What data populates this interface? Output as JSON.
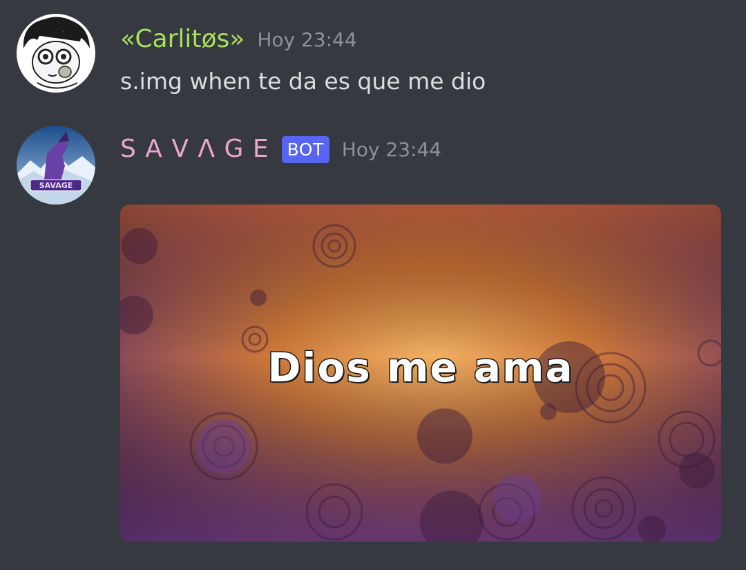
{
  "messages": [
    {
      "username": "«Carlitøs»",
      "username_color": "#a8e05f",
      "timestamp": "Hoy 23:44",
      "text": "s.img when te da es que me dio",
      "avatar": "cartoon-face-avatar"
    },
    {
      "username": "S A V Λ G E",
      "username_color": "#e8a6d0",
      "badge": "BOT",
      "timestamp": "Hoy 23:44",
      "avatar": "howling-wolf-logo-avatar",
      "avatar_logo_text": "SAVAGE",
      "embed": {
        "caption": "Dios me ama",
        "background": "grunge-orange-purple-texture"
      }
    }
  ],
  "colors": {
    "background": "#36393f",
    "text": "#dcddde",
    "muted": "#8e9297",
    "bot_badge": "#5865f2"
  }
}
